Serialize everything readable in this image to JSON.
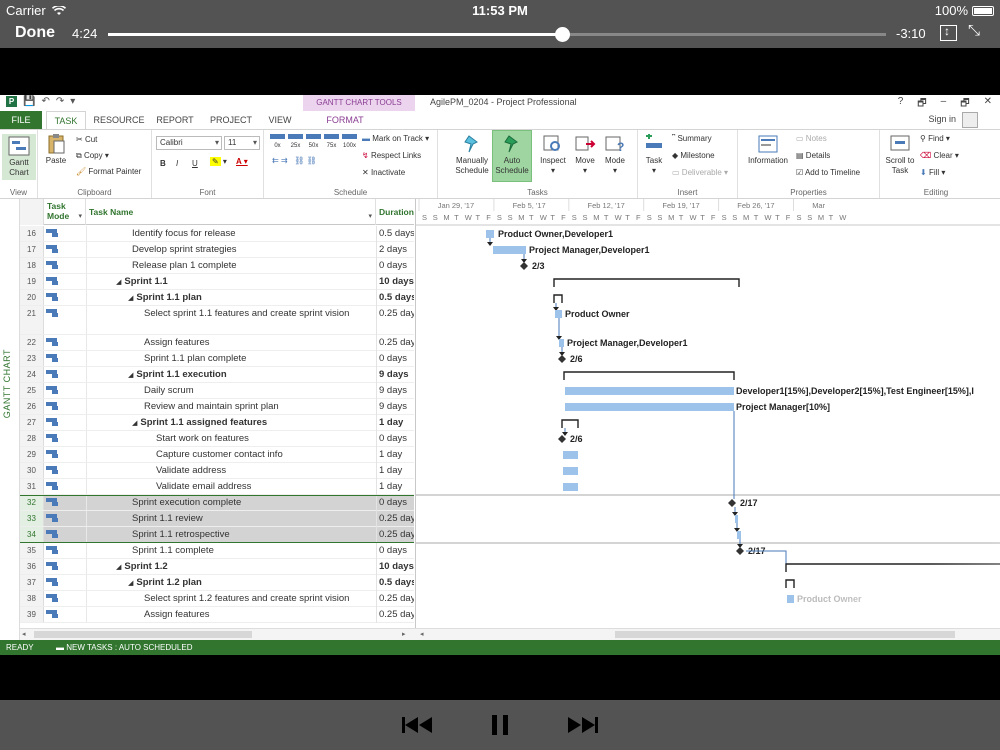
{
  "status_bar": {
    "carrier": "Carrier",
    "time": "11:53 PM",
    "battery": "100%"
  },
  "player": {
    "done_label": "Done",
    "elapsed": "4:24",
    "remaining": "-3:10",
    "progress": 0.584
  },
  "app": {
    "window_title": "AgilePM_0204 - Project Professional",
    "context_tab": "GANTT CHART TOOLS",
    "sign_in": "Sign in",
    "window_controls": [
      "?",
      "🗗",
      "–",
      "🗗",
      "✕"
    ],
    "tabs": [
      "FILE",
      "TASK",
      "RESOURCE",
      "REPORT",
      "PROJECT",
      "VIEW",
      "FORMAT"
    ],
    "active_tab": "TASK"
  },
  "ribbon": {
    "view": {
      "button": "Gantt Chart",
      "group": "View"
    },
    "clipboard": {
      "paste": "Paste",
      "cut": "Cut",
      "copy": "Copy",
      "format_painter": "Format Painter",
      "group": "Clipboard"
    },
    "font": {
      "family": "Calibri",
      "size": "11",
      "bold": "B",
      "italic": "I",
      "underline": "U",
      "group": "Font"
    },
    "schedule": {
      "pct": [
        "0x",
        "25x",
        "50x",
        "75x",
        "100x"
      ],
      "mark_on_track": "Mark on Track",
      "respect_links": "Respect Links",
      "inactivate": "Inactivate",
      "group": "Schedule"
    },
    "tasks": {
      "manually": "Manually Schedule",
      "auto": "Auto Schedule",
      "inspect": "Inspect",
      "move": "Move",
      "mode": "Mode",
      "group": "Tasks"
    },
    "insert": {
      "task": "Task",
      "summary": "Summary",
      "milestone": "Milestone",
      "deliverable": "Deliverable",
      "group": "Insert"
    },
    "properties": {
      "information": "Information",
      "notes": "Notes",
      "details": "Details",
      "add_to_timeline": "Add to Timeline",
      "group": "Properties"
    },
    "editing": {
      "scroll": "Scroll to Task",
      "find": "Find",
      "clear": "Clear",
      "fill": "Fill",
      "group": "Editing"
    }
  },
  "side_label": "GANTT CHART",
  "grid": {
    "headers": {
      "mode": "Task Mode",
      "name": "Task Name",
      "duration": "Duration"
    },
    "rows": [
      {
        "id": "16",
        "name": "Identify focus for release",
        "duration": "0.5 days",
        "level": 2,
        "bold": false,
        "tall": false,
        "sel": false
      },
      {
        "id": "17",
        "name": "Develop sprint strategies",
        "duration": "2 days",
        "level": 2,
        "bold": false,
        "tall": false,
        "sel": false
      },
      {
        "id": "18",
        "name": "Release plan 1 complete",
        "duration": "0 days",
        "level": 2,
        "bold": false,
        "tall": false,
        "sel": false
      },
      {
        "id": "19",
        "name": "Sprint 1.1",
        "duration": "10 days",
        "level": 0,
        "bold": true,
        "tall": false,
        "sel": false,
        "tri": "◢"
      },
      {
        "id": "20",
        "name": "Sprint 1.1 plan",
        "duration": "0.5 days",
        "level": 1,
        "bold": true,
        "tall": false,
        "sel": false,
        "tri": "◢"
      },
      {
        "id": "21",
        "name": "Select sprint 1.1 features and create sprint vision",
        "duration": "0.25 day",
        "level": 3,
        "bold": false,
        "tall": true,
        "sel": false
      },
      {
        "id": "22",
        "name": "Assign features",
        "duration": "0.25 day",
        "level": 3,
        "bold": false,
        "tall": false,
        "sel": false
      },
      {
        "id": "23",
        "name": "Sprint 1.1 plan complete",
        "duration": "0 days",
        "level": 3,
        "bold": false,
        "tall": false,
        "sel": false
      },
      {
        "id": "24",
        "name": "Sprint 1.1 execution",
        "duration": "9 days",
        "level": 1,
        "bold": true,
        "tall": false,
        "sel": false,
        "tri": "◢"
      },
      {
        "id": "25",
        "name": "Daily scrum",
        "duration": "9 days",
        "level": 3,
        "bold": false,
        "tall": false,
        "sel": false
      },
      {
        "id": "26",
        "name": "Review and maintain sprint plan",
        "duration": "9 days",
        "level": 3,
        "bold": false,
        "tall": false,
        "sel": false
      },
      {
        "id": "27",
        "name": "Sprint 1.1 assigned features",
        "duration": "1 day",
        "level": 2,
        "bold": true,
        "tall": false,
        "sel": false,
        "tri": "◢"
      },
      {
        "id": "28",
        "name": "Start work on features",
        "duration": "0 days",
        "level": 4,
        "bold": false,
        "tall": false,
        "sel": false
      },
      {
        "id": "29",
        "name": "Capture customer contact info",
        "duration": "1 day",
        "level": 4,
        "bold": false,
        "tall": false,
        "sel": false
      },
      {
        "id": "30",
        "name": "Validate address",
        "duration": "1 day",
        "level": 4,
        "bold": false,
        "tall": false,
        "sel": false
      },
      {
        "id": "31",
        "name": "Validate email address",
        "duration": "1 day",
        "level": 4,
        "bold": false,
        "tall": false,
        "sel": false
      },
      {
        "id": "32",
        "name": "Sprint execution complete",
        "duration": "0 days",
        "level": 2,
        "bold": false,
        "tall": false,
        "sel": true
      },
      {
        "id": "33",
        "name": "Sprint 1.1 review",
        "duration": "0.25 day",
        "level": 2,
        "bold": false,
        "tall": false,
        "sel": true
      },
      {
        "id": "34",
        "name": "Sprint 1.1 retrospective",
        "duration": "0.25 day",
        "level": 2,
        "bold": false,
        "tall": false,
        "sel": true
      },
      {
        "id": "35",
        "name": "Sprint 1.1 complete",
        "duration": "0 days",
        "level": 2,
        "bold": false,
        "tall": false,
        "sel": false
      },
      {
        "id": "36",
        "name": "Sprint 1.2",
        "duration": "10 days",
        "level": 0,
        "bold": true,
        "tall": false,
        "sel": false,
        "tri": "◢"
      },
      {
        "id": "37",
        "name": "Sprint 1.2 plan",
        "duration": "0.5 days",
        "level": 1,
        "bold": true,
        "tall": false,
        "sel": false,
        "tri": "◢"
      },
      {
        "id": "38",
        "name": "Select sprint 1.2 features and create sprint vision",
        "duration": "0.25 day",
        "level": 3,
        "bold": false,
        "tall": false,
        "sel": false
      },
      {
        "id": "39",
        "name": "Assign features",
        "duration": "0.25 day",
        "level": 3,
        "bold": false,
        "tall": false,
        "sel": false
      }
    ]
  },
  "timescale": {
    "weeks": [
      "Jan 29, '17",
      "Feb 5, '17",
      "Feb 12, '17",
      "Feb 19, '17",
      "Feb 26, '17",
      "Mar"
    ],
    "days": [
      "S",
      "S",
      "M",
      "T",
      "W",
      "T",
      "F",
      "S",
      "S",
      "M",
      "T",
      "W",
      "T",
      "F",
      "S",
      "S",
      "M",
      "T",
      "W",
      "T",
      "F",
      "S",
      "S",
      "M",
      "T",
      "W",
      "T",
      "F",
      "S",
      "S",
      "M",
      "T",
      "W",
      "T",
      "F",
      "S",
      "S",
      "M",
      "T",
      "W"
    ]
  },
  "gantt_labels": {
    "r16": "Product Owner,Developer1",
    "r17": "Project Manager,Developer1",
    "r18": "2/3",
    "r21": "Product Owner",
    "r22": "Project Manager,Developer1",
    "r23": "2/6",
    "r25": "Developer1[15%],Developer2[15%],Test Engineer[15%],I",
    "r26": "Project Manager[10%]",
    "r28": "2/6",
    "r32": "2/17",
    "r35": "2/17",
    "r38": "Product Owner"
  },
  "statusbar": {
    "ready": "READY",
    "new_tasks": "NEW TASKS : AUTO SCHEDULED"
  },
  "colors": {
    "accent": "#31752f",
    "bar": "#9dc3ea",
    "milestone": "#333333",
    "selection": "#d3d3d3"
  },
  "icons": [
    "wifi-icon",
    "battery-icon",
    "aspect-icon",
    "shrink-icon",
    "rewind-icon",
    "pause-icon",
    "fast-forward-icon"
  ]
}
